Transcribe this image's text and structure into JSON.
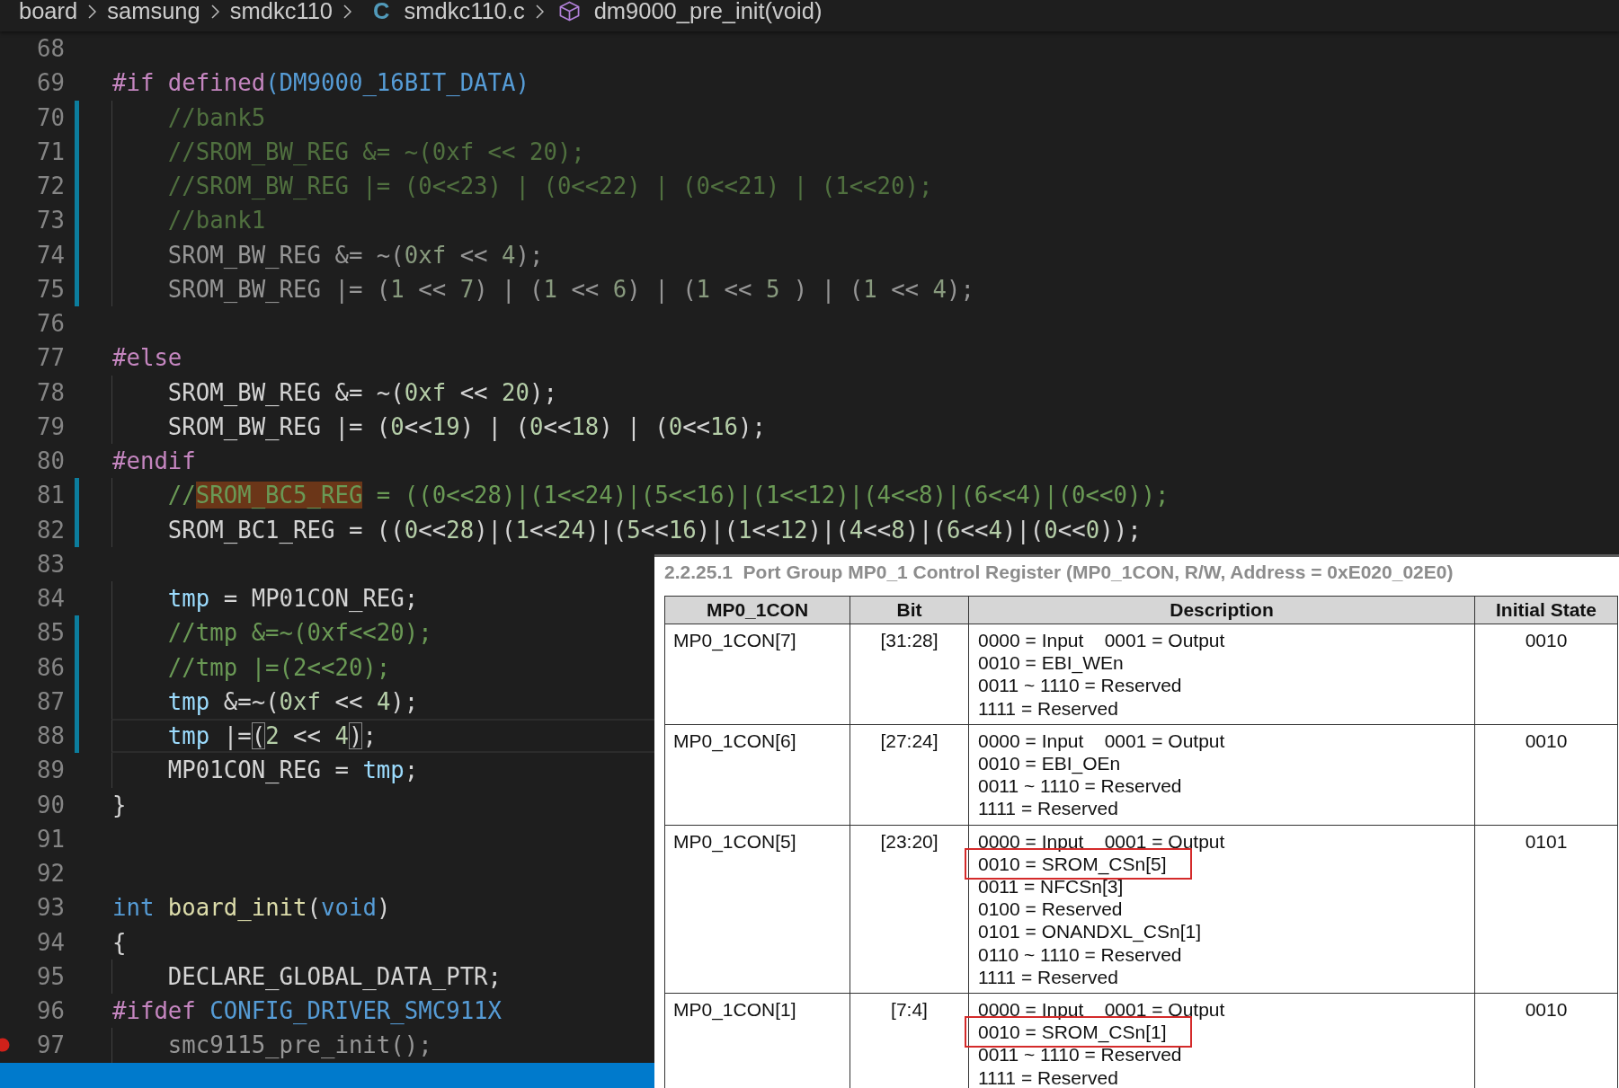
{
  "breadcrumb": {
    "items": [
      {
        "label": "board",
        "kind": "folder"
      },
      {
        "label": "samsung",
        "kind": "folder"
      },
      {
        "label": "smdkc110",
        "kind": "folder"
      },
      {
        "label": "smdkc110.c",
        "kind": "file",
        "icon": "C"
      },
      {
        "label": "dm9000_pre_init(void)",
        "kind": "symbol"
      }
    ]
  },
  "editor": {
    "lines": [
      {
        "number": "68",
        "modified": false,
        "breakpoint": false,
        "current": false
      },
      {
        "number": "69",
        "modified": false,
        "inactive": false,
        "breakpoint": false,
        "current": false,
        "tokens": [
          {
            "text": "#if",
            "kind": "directive"
          },
          {
            "text": " defined",
            "kind": "directive"
          },
          {
            "text": "(DM9000_16BIT_DATA)",
            "kind": "macro"
          }
        ]
      },
      {
        "number": "70",
        "modified": true,
        "inactive": true,
        "breakpoint": false,
        "current": false,
        "tokens": [
          {
            "text": "    //bank5",
            "kind": "comment"
          }
        ]
      },
      {
        "number": "71",
        "modified": true,
        "inactive": true,
        "breakpoint": false,
        "current": false,
        "tokens": [
          {
            "text": "    //SROM_BW_REG &= ~(0xf << 20);",
            "kind": "comment"
          }
        ]
      },
      {
        "number": "72",
        "modified": true,
        "inactive": true,
        "breakpoint": false,
        "current": false,
        "tokens": [
          {
            "text": "    //SROM_BW_REG |= (0<<23) | (0<<22) | (0<<21) | (1<<20);",
            "kind": "comment"
          }
        ]
      },
      {
        "number": "73",
        "modified": true,
        "inactive": true,
        "breakpoint": false,
        "current": false,
        "tokens": [
          {
            "text": "    //bank1",
            "kind": "comment"
          }
        ]
      },
      {
        "number": "74",
        "modified": true,
        "inactive": true,
        "breakpoint": false,
        "current": false,
        "tokens": [
          {
            "text": "    SROM_BW_REG &= ~(",
            "kind": "plain"
          },
          {
            "text": "0xf",
            "kind": "number"
          },
          {
            "text": " << ",
            "kind": "plain"
          },
          {
            "text": "4",
            "kind": "number"
          },
          {
            "text": ");",
            "kind": "plain"
          }
        ]
      },
      {
        "number": "75",
        "modified": true,
        "inactive": true,
        "breakpoint": false,
        "current": false,
        "tokens": [
          {
            "text": "    SROM_BW_REG |= (",
            "kind": "plain"
          },
          {
            "text": "1",
            "kind": "number"
          },
          {
            "text": " << ",
            "kind": "plain"
          },
          {
            "text": "7",
            "kind": "number"
          },
          {
            "text": ") | (",
            "kind": "plain"
          },
          {
            "text": "1",
            "kind": "number"
          },
          {
            "text": " << ",
            "kind": "plain"
          },
          {
            "text": "6",
            "kind": "number"
          },
          {
            "text": ") | (",
            "kind": "plain"
          },
          {
            "text": "1",
            "kind": "number"
          },
          {
            "text": " << ",
            "kind": "plain"
          },
          {
            "text": "5",
            "kind": "number"
          },
          {
            "text": " ) | (",
            "kind": "plain"
          },
          {
            "text": "1",
            "kind": "number"
          },
          {
            "text": " << ",
            "kind": "plain"
          },
          {
            "text": "4",
            "kind": "number"
          },
          {
            "text": ");",
            "kind": "plain"
          }
        ]
      },
      {
        "number": "76",
        "modified": false,
        "breakpoint": false,
        "current": false
      },
      {
        "number": "77",
        "modified": false,
        "inactive": false,
        "breakpoint": false,
        "current": false,
        "tokens": [
          {
            "text": "#else",
            "kind": "directive"
          }
        ]
      },
      {
        "number": "78",
        "modified": false,
        "inactive": false,
        "breakpoint": false,
        "current": false,
        "tokens": [
          {
            "text": "    SROM_BW_REG &= ~(",
            "kind": "plain"
          },
          {
            "text": "0xf",
            "kind": "number"
          },
          {
            "text": " << ",
            "kind": "plain"
          },
          {
            "text": "20",
            "kind": "number"
          },
          {
            "text": ");",
            "kind": "plain"
          }
        ]
      },
      {
        "number": "79",
        "modified": false,
        "inactive": false,
        "breakpoint": false,
        "current": false,
        "tokens": [
          {
            "text": "    SROM_BW_REG |= (",
            "kind": "plain"
          },
          {
            "text": "0",
            "kind": "number"
          },
          {
            "text": "<<",
            "kind": "plain"
          },
          {
            "text": "19",
            "kind": "number"
          },
          {
            "text": ") | (",
            "kind": "plain"
          },
          {
            "text": "0",
            "kind": "number"
          },
          {
            "text": "<<",
            "kind": "plain"
          },
          {
            "text": "18",
            "kind": "number"
          },
          {
            "text": ") | (",
            "kind": "plain"
          },
          {
            "text": "0",
            "kind": "number"
          },
          {
            "text": "<<",
            "kind": "plain"
          },
          {
            "text": "16",
            "kind": "number"
          },
          {
            "text": ");",
            "kind": "plain"
          }
        ]
      },
      {
        "number": "80",
        "modified": false,
        "inactive": false,
        "breakpoint": false,
        "current": false,
        "tokens": [
          {
            "text": "#endif",
            "kind": "directive"
          }
        ]
      },
      {
        "number": "81",
        "modified": true,
        "inactive": false,
        "breakpoint": false,
        "current": false,
        "tokens": [
          {
            "text": "    //",
            "kind": "comment"
          },
          {
            "text": "SROM_BC5_REG",
            "kind": "match"
          },
          {
            "text": " = ((0<<28)|(1<<24)|(5<<16)|(1<<12)|(4<<8)|(6<<4)|(0<<0));",
            "kind": "comment"
          }
        ]
      },
      {
        "number": "82",
        "modified": true,
        "inactive": false,
        "breakpoint": false,
        "current": false,
        "tokens": [
          {
            "text": "    SROM_BC1_REG = ((",
            "kind": "plain"
          },
          {
            "text": "0",
            "kind": "number"
          },
          {
            "text": "<<",
            "kind": "plain"
          },
          {
            "text": "28",
            "kind": "number"
          },
          {
            "text": ")|(",
            "kind": "plain"
          },
          {
            "text": "1",
            "kind": "number"
          },
          {
            "text": "<<",
            "kind": "plain"
          },
          {
            "text": "24",
            "kind": "number"
          },
          {
            "text": ")|(",
            "kind": "plain"
          },
          {
            "text": "5",
            "kind": "number"
          },
          {
            "text": "<<",
            "kind": "plain"
          },
          {
            "text": "16",
            "kind": "number"
          },
          {
            "text": ")|(",
            "kind": "plain"
          },
          {
            "text": "1",
            "kind": "number"
          },
          {
            "text": "<<",
            "kind": "plain"
          },
          {
            "text": "12",
            "kind": "number"
          },
          {
            "text": ")|(",
            "kind": "plain"
          },
          {
            "text": "4",
            "kind": "number"
          },
          {
            "text": "<<",
            "kind": "plain"
          },
          {
            "text": "8",
            "kind": "number"
          },
          {
            "text": ")|(",
            "kind": "plain"
          },
          {
            "text": "6",
            "kind": "number"
          },
          {
            "text": "<<",
            "kind": "plain"
          },
          {
            "text": "4",
            "kind": "number"
          },
          {
            "text": ")|(",
            "kind": "plain"
          },
          {
            "text": "0",
            "kind": "number"
          },
          {
            "text": "<<",
            "kind": "plain"
          },
          {
            "text": "0",
            "kind": "number"
          },
          {
            "text": "));",
            "kind": "plain"
          }
        ]
      },
      {
        "number": "83",
        "modified": false,
        "breakpoint": false,
        "current": false
      },
      {
        "number": "84",
        "modified": false,
        "inactive": false,
        "breakpoint": false,
        "current": false,
        "tokens": [
          {
            "text": "    tmp",
            "kind": "variable"
          },
          {
            "text": " = MP01CON_REG;",
            "kind": "plain"
          }
        ]
      },
      {
        "number": "85",
        "modified": true,
        "inactive": false,
        "breakpoint": false,
        "current": false,
        "tokens": [
          {
            "text": "    //tmp &=~(0xf<<20);",
            "kind": "comment"
          }
        ]
      },
      {
        "number": "86",
        "modified": true,
        "inactive": false,
        "breakpoint": false,
        "current": false,
        "tokens": [
          {
            "text": "    //tmp |=(2<<20);",
            "kind": "comment"
          }
        ]
      },
      {
        "number": "87",
        "modified": true,
        "inactive": false,
        "breakpoint": false,
        "current": false,
        "tokens": [
          {
            "text": "    tmp",
            "kind": "variable"
          },
          {
            "text": " &=~(",
            "kind": "plain"
          },
          {
            "text": "0xf",
            "kind": "number"
          },
          {
            "text": " << ",
            "kind": "plain"
          },
          {
            "text": "4",
            "kind": "number"
          },
          {
            "text": ");",
            "kind": "plain"
          }
        ]
      },
      {
        "number": "88",
        "modified": true,
        "inactive": false,
        "breakpoint": false,
        "current": true,
        "tokens": [
          {
            "text": "    tmp",
            "kind": "variable"
          },
          {
            "text": " |=",
            "kind": "plain"
          },
          {
            "text": "(",
            "kind": "bracket"
          },
          {
            "text": "2",
            "kind": "number"
          },
          {
            "text": " << ",
            "kind": "plain"
          },
          {
            "text": "4",
            "kind": "number"
          },
          {
            "text": ")",
            "kind": "bracket"
          },
          {
            "text": ";",
            "kind": "plain"
          }
        ]
      },
      {
        "number": "89",
        "modified": false,
        "inactive": false,
        "breakpoint": false,
        "current": false,
        "tokens": [
          {
            "text": "    MP01CON_REG = ",
            "kind": "plain"
          },
          {
            "text": "tmp",
            "kind": "variable"
          },
          {
            "text": ";",
            "kind": "plain"
          }
        ]
      },
      {
        "number": "90",
        "modified": false,
        "inactive": false,
        "breakpoint": false,
        "current": false,
        "tokens": [
          {
            "text": "}",
            "kind": "plain"
          }
        ]
      },
      {
        "number": "91",
        "modified": false,
        "breakpoint": false,
        "current": false
      },
      {
        "number": "92",
        "modified": false,
        "breakpoint": false,
        "current": false
      },
      {
        "number": "93",
        "modified": false,
        "inactive": false,
        "breakpoint": false,
        "current": false,
        "tokens": [
          {
            "text": "int",
            "kind": "type"
          },
          {
            "text": " board_init",
            "kind": "function"
          },
          {
            "text": "(",
            "kind": "plain"
          },
          {
            "text": "void",
            "kind": "type"
          },
          {
            "text": ")",
            "kind": "plain"
          }
        ]
      },
      {
        "number": "94",
        "modified": false,
        "inactive": false,
        "breakpoint": false,
        "current": false,
        "tokens": [
          {
            "text": "{",
            "kind": "plain"
          }
        ]
      },
      {
        "number": "95",
        "modified": false,
        "inactive": false,
        "breakpoint": false,
        "current": false,
        "tokens": [
          {
            "text": "    DECLARE_GLOBAL_DATA_PTR;",
            "kind": "plain"
          }
        ]
      },
      {
        "number": "96",
        "modified": false,
        "inactive": false,
        "breakpoint": false,
        "current": false,
        "tokens": [
          {
            "text": "#ifdef",
            "kind": "directive"
          },
          {
            "text": " CONFIG_DRIVER_SMC911X",
            "kind": "macro"
          }
        ]
      },
      {
        "number": "97",
        "modified": false,
        "inactive": true,
        "breakpoint": true,
        "current": false,
        "tokens": [
          {
            "text": "    smc9115_pre_init();",
            "kind": "plain"
          }
        ]
      }
    ]
  },
  "datasheet": {
    "title": "2.2.25.1  Port Group MP0_1 Control Register (MP0_1CON, R/W, Address = 0xE020_02E0)",
    "columns": [
      "MP0_1CON",
      "Bit",
      "Description",
      "Initial State"
    ],
    "rows": [
      {
        "register": "MP0_1CON[7]",
        "bit": "[31:28]",
        "description": [
          {
            "text": "0000 = Input    0001 = Output",
            "boxed": false
          },
          {
            "text": "0010 = EBI_WEn",
            "boxed": false
          },
          {
            "text": "0011 ~ 1110 = Reserved",
            "boxed": false
          },
          {
            "text": "1111 = Reserved",
            "boxed": false
          }
        ],
        "initial_state": "0010"
      },
      {
        "register": "MP0_1CON[6]",
        "bit": "[27:24]",
        "description": [
          {
            "text": "0000 = Input    0001 = Output",
            "boxed": false
          },
          {
            "text": "0010 = EBI_OEn",
            "boxed": false
          },
          {
            "text": "0011 ~ 1110 = Reserved",
            "boxed": false
          },
          {
            "text": "1111 = Reserved",
            "boxed": false
          }
        ],
        "initial_state": "0010"
      },
      {
        "register": "MP0_1CON[5]",
        "bit": "[23:20]",
        "description": [
          {
            "text": "0000 = Input    0001 = Output",
            "boxed": false
          },
          {
            "text": "0010 = SROM_CSn[5]",
            "boxed": true
          },
          {
            "text": "0011 = NFCSn[3]",
            "boxed": false
          },
          {
            "text": "0100 = Reserved",
            "boxed": false
          },
          {
            "text": "0101 = ONANDXL_CSn[1]",
            "boxed": false
          },
          {
            "text": "0110 ~ 1110 = Reserved",
            "boxed": false
          },
          {
            "text": "1111 = Reserved",
            "boxed": false
          }
        ],
        "initial_state": "0101"
      },
      {
        "register": "MP0_1CON[1]",
        "bit": "[7:4]",
        "description": [
          {
            "text": "0000 = Input    0001 = Output",
            "boxed": false
          },
          {
            "text": "0010 = SROM_CSn[1]",
            "boxed": true
          },
          {
            "text": "0011 ~ 1110 = Reserved",
            "boxed": false
          },
          {
            "text": "1111 = Reserved",
            "boxed": false
          }
        ],
        "initial_state": "0010"
      }
    ]
  }
}
